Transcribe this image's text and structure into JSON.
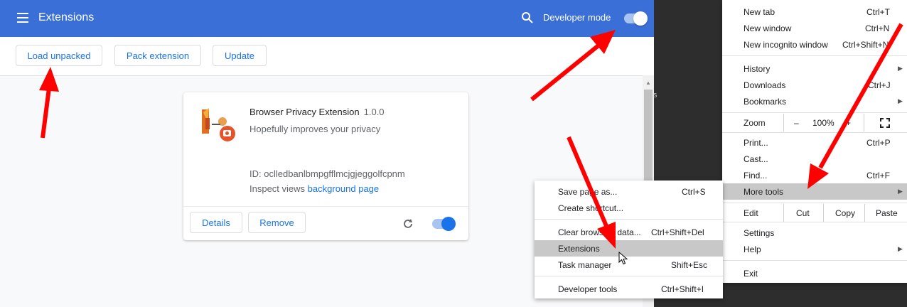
{
  "header": {
    "title": "Extensions",
    "developer_mode_label": "Developer mode",
    "developer_mode_on": true
  },
  "toolbar": {
    "load_unpacked": "Load unpacked",
    "pack_extension": "Pack extension",
    "update": "Update"
  },
  "extension_card": {
    "name": "Browser Privacy Extension",
    "version": "1.0.0",
    "description": "Hopefully improves your privacy",
    "id_label": "ID:",
    "id_value": "oclledbanlbmpgfflmcjgjeggolfcpnm",
    "inspect_label": "Inspect views",
    "inspect_link": "background page",
    "details_button": "Details",
    "remove_button": "Remove",
    "enabled": true
  },
  "background_text": "s",
  "chrome_menu": {
    "items": [
      {
        "label": "New tab",
        "shortcut": "Ctrl+T"
      },
      {
        "label": "New window",
        "shortcut": "Ctrl+N"
      },
      {
        "label": "New incognito window",
        "shortcut": "Ctrl+Shift+N"
      },
      {
        "label": "History",
        "shortcut": ""
      },
      {
        "label": "Downloads",
        "shortcut": "Ctrl+J"
      },
      {
        "label": "Bookmarks",
        "shortcut": ""
      },
      {
        "label": "Print...",
        "shortcut": "Ctrl+P"
      },
      {
        "label": "Cast...",
        "shortcut": ""
      },
      {
        "label": "Find...",
        "shortcut": "Ctrl+F"
      },
      {
        "label": "More tools",
        "shortcut": ""
      },
      {
        "label": "Settings",
        "shortcut": ""
      },
      {
        "label": "Help",
        "shortcut": ""
      },
      {
        "label": "Exit",
        "shortcut": ""
      }
    ],
    "zoom": {
      "label": "Zoom",
      "minus": "–",
      "value": "100%",
      "plus": "+"
    },
    "edit": {
      "label": "Edit",
      "cut": "Cut",
      "copy": "Copy",
      "paste": "Paste"
    }
  },
  "more_tools_menu": {
    "items": [
      {
        "label": "Save page as...",
        "shortcut": "Ctrl+S"
      },
      {
        "label": "Create shortcut...",
        "shortcut": ""
      },
      {
        "label": "Clear browsing data...",
        "shortcut": "Ctrl+Shift+Del"
      },
      {
        "label": "Extensions",
        "shortcut": ""
      },
      {
        "label": "Task manager",
        "shortcut": "Shift+Esc"
      },
      {
        "label": "Developer tools",
        "shortcut": "Ctrl+Shift+I"
      }
    ]
  },
  "colors": {
    "header_blue": "#3b6fd8",
    "link_blue": "#1a73e8",
    "toggle_on": "#1a73e8",
    "arrow_red": "#ff0000",
    "menu_highlight": "#c8c8c8"
  },
  "icons": [
    "menu-icon",
    "search-icon",
    "extension-logo",
    "reload-icon",
    "fullscreen-icon",
    "submenu-arrow-icon",
    "mouse-cursor-icon",
    "annotation-arrow"
  ]
}
